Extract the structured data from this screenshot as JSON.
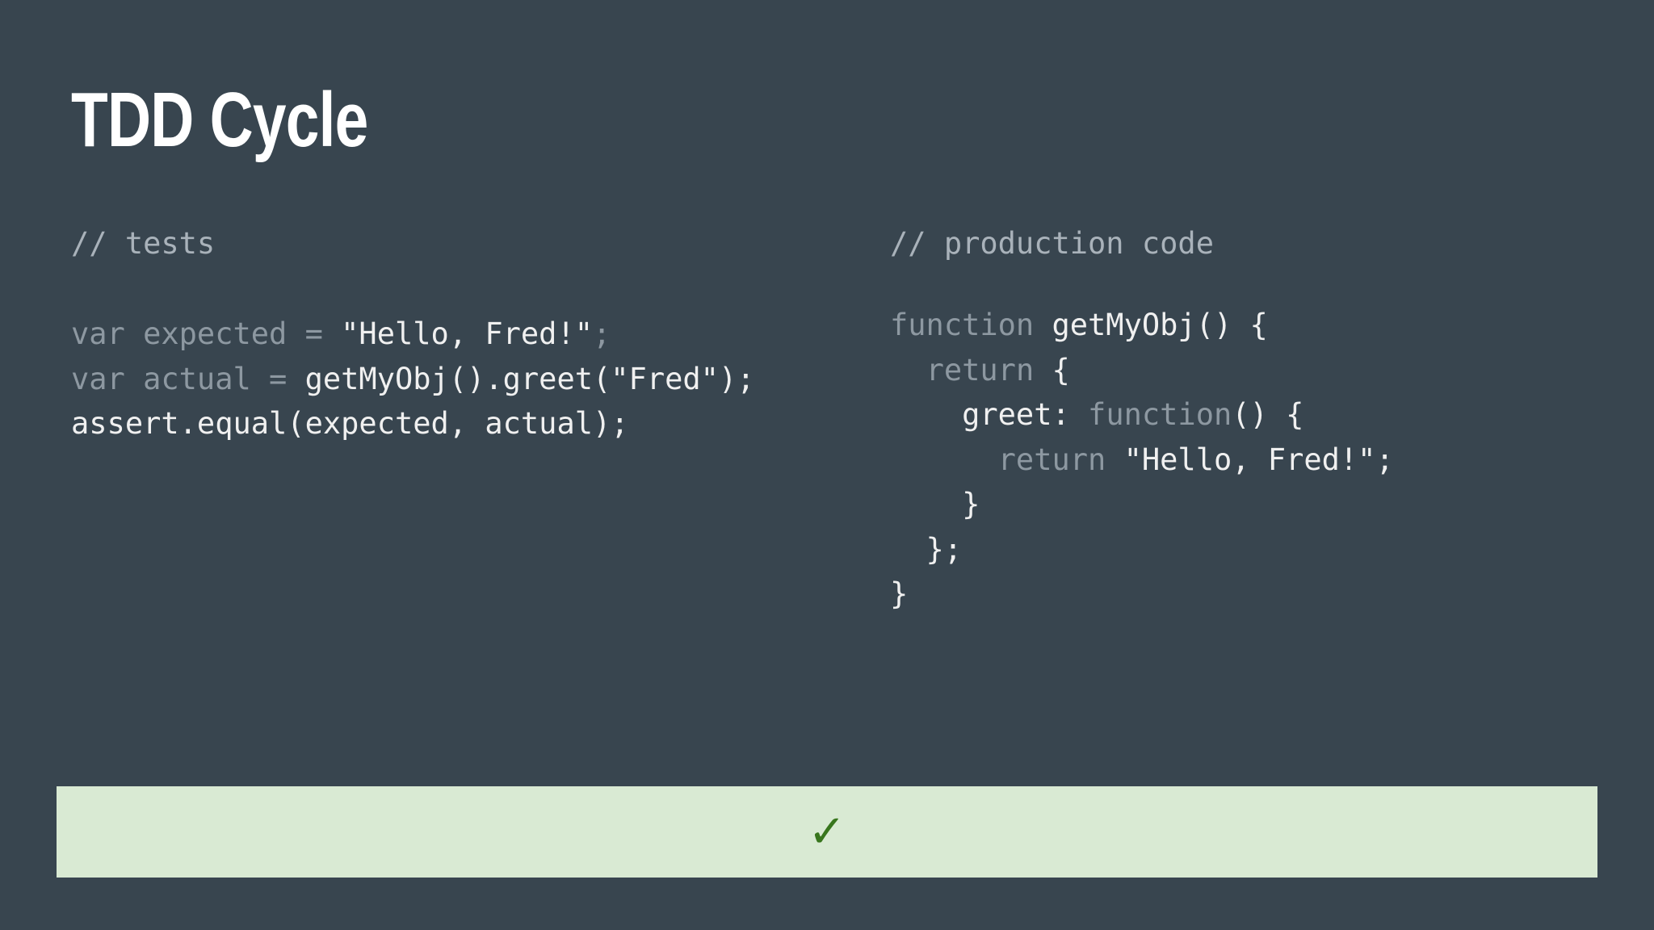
{
  "slide": {
    "title": "TDD Cycle"
  },
  "colors": {
    "background": "#38454f",
    "title": "#ffffff",
    "code_text": "#f0f0f0",
    "keyword_muted": "#8d98a1",
    "comment": "#a9b2ba",
    "result_bar_bg": "#d9ead3",
    "check": "#38761d"
  },
  "tests": {
    "comment": "// tests",
    "lines": [
      [
        {
          "text": "var expected = ",
          "muted": true
        },
        {
          "text": "\"Hello, Fred!\"",
          "muted": false
        },
        {
          "text": ";",
          "muted": true
        }
      ],
      [
        {
          "text": "var actual = ",
          "muted": true
        },
        {
          "text": "getMyObj().greet(\"Fred\");",
          "muted": false
        }
      ],
      [
        {
          "text": "assert.equal(expected, actual);",
          "muted": false
        }
      ]
    ]
  },
  "production": {
    "comment": "// production code",
    "lines": [
      [
        {
          "text": "function ",
          "muted": true
        },
        {
          "text": "getMyObj() {",
          "muted": false
        }
      ],
      [
        {
          "text": "  ",
          "muted": false
        },
        {
          "text": "return",
          "muted": true
        },
        {
          "text": " {",
          "muted": false
        }
      ],
      [
        {
          "text": "    greet: ",
          "muted": false
        },
        {
          "text": "function",
          "muted": true
        },
        {
          "text": "() {",
          "muted": false
        }
      ],
      [
        {
          "text": "      ",
          "muted": false
        },
        {
          "text": "return",
          "muted": true
        },
        {
          "text": " \"Hello, Fred!\";",
          "muted": false
        }
      ],
      [
        {
          "text": "    }",
          "muted": false
        }
      ],
      [
        {
          "text": "  };",
          "muted": false
        }
      ],
      [
        {
          "text": "}",
          "muted": false
        }
      ]
    ]
  },
  "result": {
    "icon": "check-icon",
    "symbol": "✓",
    "status": "pass"
  }
}
